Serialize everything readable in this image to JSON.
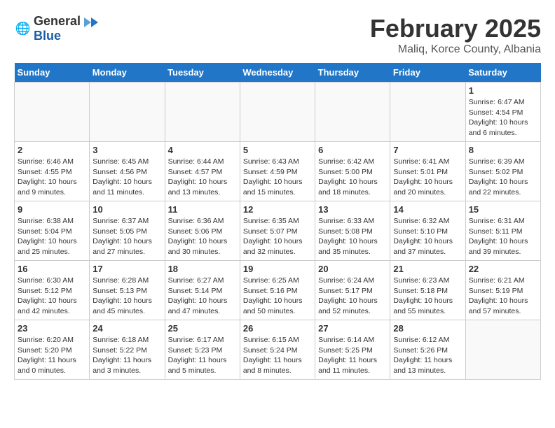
{
  "logo": {
    "general": "General",
    "blue": "Blue"
  },
  "header": {
    "month": "February 2025",
    "location": "Maliq, Korce County, Albania"
  },
  "weekdays": [
    "Sunday",
    "Monday",
    "Tuesday",
    "Wednesday",
    "Thursday",
    "Friday",
    "Saturday"
  ],
  "weeks": [
    [
      {
        "day": "",
        "info": ""
      },
      {
        "day": "",
        "info": ""
      },
      {
        "day": "",
        "info": ""
      },
      {
        "day": "",
        "info": ""
      },
      {
        "day": "",
        "info": ""
      },
      {
        "day": "",
        "info": ""
      },
      {
        "day": "1",
        "info": "Sunrise: 6:47 AM\nSunset: 4:54 PM\nDaylight: 10 hours and 6 minutes."
      }
    ],
    [
      {
        "day": "2",
        "info": "Sunrise: 6:46 AM\nSunset: 4:55 PM\nDaylight: 10 hours and 9 minutes."
      },
      {
        "day": "3",
        "info": "Sunrise: 6:45 AM\nSunset: 4:56 PM\nDaylight: 10 hours and 11 minutes."
      },
      {
        "day": "4",
        "info": "Sunrise: 6:44 AM\nSunset: 4:57 PM\nDaylight: 10 hours and 13 minutes."
      },
      {
        "day": "5",
        "info": "Sunrise: 6:43 AM\nSunset: 4:59 PM\nDaylight: 10 hours and 15 minutes."
      },
      {
        "day": "6",
        "info": "Sunrise: 6:42 AM\nSunset: 5:00 PM\nDaylight: 10 hours and 18 minutes."
      },
      {
        "day": "7",
        "info": "Sunrise: 6:41 AM\nSunset: 5:01 PM\nDaylight: 10 hours and 20 minutes."
      },
      {
        "day": "8",
        "info": "Sunrise: 6:39 AM\nSunset: 5:02 PM\nDaylight: 10 hours and 22 minutes."
      }
    ],
    [
      {
        "day": "9",
        "info": "Sunrise: 6:38 AM\nSunset: 5:04 PM\nDaylight: 10 hours and 25 minutes."
      },
      {
        "day": "10",
        "info": "Sunrise: 6:37 AM\nSunset: 5:05 PM\nDaylight: 10 hours and 27 minutes."
      },
      {
        "day": "11",
        "info": "Sunrise: 6:36 AM\nSunset: 5:06 PM\nDaylight: 10 hours and 30 minutes."
      },
      {
        "day": "12",
        "info": "Sunrise: 6:35 AM\nSunset: 5:07 PM\nDaylight: 10 hours and 32 minutes."
      },
      {
        "day": "13",
        "info": "Sunrise: 6:33 AM\nSunset: 5:08 PM\nDaylight: 10 hours and 35 minutes."
      },
      {
        "day": "14",
        "info": "Sunrise: 6:32 AM\nSunset: 5:10 PM\nDaylight: 10 hours and 37 minutes."
      },
      {
        "day": "15",
        "info": "Sunrise: 6:31 AM\nSunset: 5:11 PM\nDaylight: 10 hours and 39 minutes."
      }
    ],
    [
      {
        "day": "16",
        "info": "Sunrise: 6:30 AM\nSunset: 5:12 PM\nDaylight: 10 hours and 42 minutes."
      },
      {
        "day": "17",
        "info": "Sunrise: 6:28 AM\nSunset: 5:13 PM\nDaylight: 10 hours and 45 minutes."
      },
      {
        "day": "18",
        "info": "Sunrise: 6:27 AM\nSunset: 5:14 PM\nDaylight: 10 hours and 47 minutes."
      },
      {
        "day": "19",
        "info": "Sunrise: 6:25 AM\nSunset: 5:16 PM\nDaylight: 10 hours and 50 minutes."
      },
      {
        "day": "20",
        "info": "Sunrise: 6:24 AM\nSunset: 5:17 PM\nDaylight: 10 hours and 52 minutes."
      },
      {
        "day": "21",
        "info": "Sunrise: 6:23 AM\nSunset: 5:18 PM\nDaylight: 10 hours and 55 minutes."
      },
      {
        "day": "22",
        "info": "Sunrise: 6:21 AM\nSunset: 5:19 PM\nDaylight: 10 hours and 57 minutes."
      }
    ],
    [
      {
        "day": "23",
        "info": "Sunrise: 6:20 AM\nSunset: 5:20 PM\nDaylight: 11 hours and 0 minutes."
      },
      {
        "day": "24",
        "info": "Sunrise: 6:18 AM\nSunset: 5:22 PM\nDaylight: 11 hours and 3 minutes."
      },
      {
        "day": "25",
        "info": "Sunrise: 6:17 AM\nSunset: 5:23 PM\nDaylight: 11 hours and 5 minutes."
      },
      {
        "day": "26",
        "info": "Sunrise: 6:15 AM\nSunset: 5:24 PM\nDaylight: 11 hours and 8 minutes."
      },
      {
        "day": "27",
        "info": "Sunrise: 6:14 AM\nSunset: 5:25 PM\nDaylight: 11 hours and 11 minutes."
      },
      {
        "day": "28",
        "info": "Sunrise: 6:12 AM\nSunset: 5:26 PM\nDaylight: 11 hours and 13 minutes."
      },
      {
        "day": "",
        "info": ""
      }
    ]
  ]
}
